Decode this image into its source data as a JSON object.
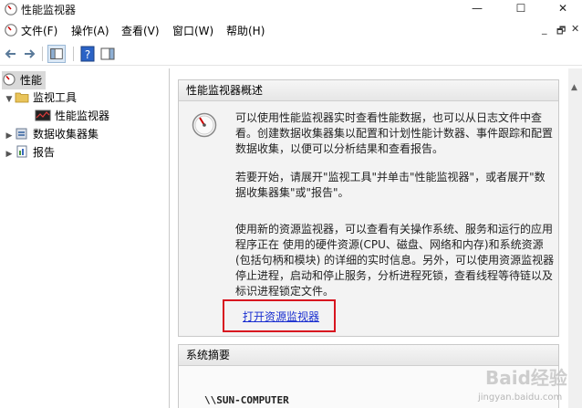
{
  "window": {
    "title": "性能监视器",
    "min": "—",
    "max": "☐",
    "close": "✕"
  },
  "menu": [
    {
      "label": "文件(F)"
    },
    {
      "label": "操作(A)"
    },
    {
      "label": "查看(V)"
    },
    {
      "label": "窗口(W)"
    },
    {
      "label": "帮助(H)"
    }
  ],
  "mdi": {
    "min": "_",
    "restore": "🗗",
    "close": "✕"
  },
  "toolbar": {
    "icons": [
      "back-arrow-icon",
      "forward-arrow-icon",
      "show-hide-console-tree-icon",
      "help-icon",
      "show-hide-action-pane-icon"
    ],
    "help_glyph": "?"
  },
  "tree": {
    "root": "性能",
    "monitoring_tools": "监视工具",
    "perf_monitor": "性能监视器",
    "data_collector_sets": "数据收集器集",
    "reports": "报告"
  },
  "overview": {
    "title": "性能监视器概述",
    "p1": "可以使用性能监视器实时查看性能数据，也可以从日志文件中查看。创建数据收集器集以配置和计划性能计数器、事件跟踪和配置数据收集，以便可以分析结果和查看报告。",
    "p2": "若要开始，请展开\"监视工具\"并单击\"性能监视器\"，或者展开\"数据收集器集\"或\"报告\"。",
    "p3": "使用新的资源监视器，可以查看有关操作系统、服务和运行的应用程序正在 使用的硬件资源(CPU、磁盘、网络和内存)和系统资源(包括句柄和模块) 的详细的实时信息。另外，可以使用资源监视器停止进程，启动和停止服务，分析进程死锁，查看线程等待链以及标识进程锁定文件。",
    "link": "打开资源监视器"
  },
  "summary": {
    "title": "系统摘要",
    "computer": "\\\\SUN-COMPUTER"
  },
  "watermark": {
    "text": "Baid经验",
    "url": "jingyan.baidu.com"
  },
  "colors": {
    "link": "#1a2fd0",
    "highlight_box": "#d8151f",
    "selected_row": "#d9d9d9"
  }
}
